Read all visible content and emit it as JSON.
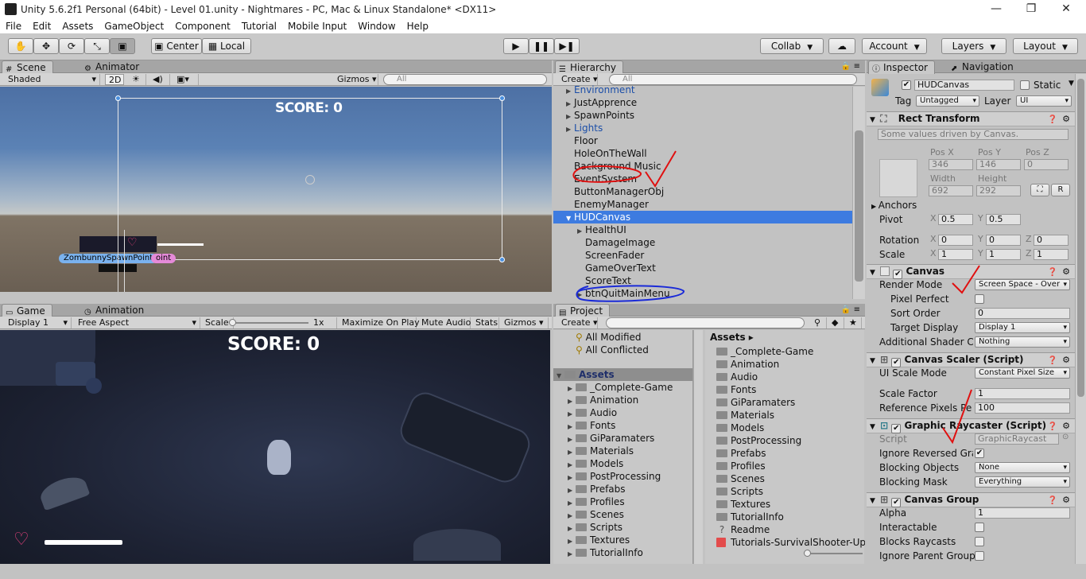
{
  "window": {
    "title": "Unity 5.6.2f1 Personal (64bit) - Level 01.unity - Nightmares - PC, Mac & Linux Standalone* <DX11>"
  },
  "menu": [
    "File",
    "Edit",
    "Assets",
    "GameObject",
    "Component",
    "Tutorial",
    "Mobile Input",
    "Window",
    "Help"
  ],
  "toolbar": {
    "center": "Center",
    "local": "Local",
    "collab": "Collab",
    "account": "Account",
    "layers": "Layers",
    "layout": "Layout"
  },
  "scene": {
    "tabs": [
      "Scene",
      "Animator"
    ],
    "shading": "Shaded",
    "mode2d": "2D",
    "gizmos": "Gizmos",
    "search": "All",
    "score": "SCORE: 0",
    "spawn_label": "ZombunnySpawnPoint",
    "spawn_label_tail": "oint"
  },
  "game": {
    "tabs": [
      "Game",
      "Animation"
    ],
    "display": "Display 1",
    "aspect": "Free Aspect",
    "scale_label": "Scale",
    "scale_value": "1x",
    "maximize": "Maximize On Play",
    "mute": "Mute Audio",
    "stats": "Stats",
    "gizmos": "Gizmos",
    "score": "SCORE: 0"
  },
  "hierarchy": {
    "tab": "Hierarchy",
    "create": "Create",
    "search": "All",
    "items": [
      {
        "label": "Environment",
        "indent": 1,
        "arrow": "▶",
        "blue": true
      },
      {
        "label": "JustApprence",
        "indent": 1,
        "arrow": "▶",
        "blue": false
      },
      {
        "label": "SpawnPoints",
        "indent": 1,
        "arrow": "▶",
        "blue": false
      },
      {
        "label": "Lights",
        "indent": 1,
        "arrow": "▶",
        "blue": true
      },
      {
        "label": "Floor",
        "indent": 1,
        "arrow": "",
        "blue": false
      },
      {
        "label": "HoleOnTheWall",
        "indent": 1,
        "arrow": "",
        "blue": false
      },
      {
        "label": "Background Music",
        "indent": 1,
        "arrow": "",
        "blue": false
      },
      {
        "label": "EventSystem",
        "indent": 1,
        "arrow": "",
        "blue": false
      },
      {
        "label": "ButtonManagerObj",
        "indent": 1,
        "arrow": "",
        "blue": false
      },
      {
        "label": "EnemyManager",
        "indent": 1,
        "arrow": "",
        "blue": false
      },
      {
        "label": "HUDCanvas",
        "indent": 1,
        "arrow": "▼",
        "blue": false,
        "selected": true
      },
      {
        "label": "HealthUI",
        "indent": 2,
        "arrow": "▶",
        "blue": false
      },
      {
        "label": "DamageImage",
        "indent": 2,
        "arrow": "",
        "blue": false
      },
      {
        "label": "ScreenFader",
        "indent": 2,
        "arrow": "",
        "blue": false
      },
      {
        "label": "GameOverText",
        "indent": 2,
        "arrow": "",
        "blue": false
      },
      {
        "label": "ScoreText",
        "indent": 2,
        "arrow": "",
        "blue": false
      },
      {
        "label": "btnQuitMainMenu",
        "indent": 2,
        "arrow": "▶",
        "blue": false
      }
    ]
  },
  "project": {
    "tab": "Project",
    "create": "Create",
    "favorites": [
      "All Modified",
      "All Conflicted"
    ],
    "tree_root": "Assets",
    "tree": [
      "_Complete-Game",
      "Animation",
      "Audio",
      "Fonts",
      "GiParamaters",
      "Materials",
      "Models",
      "PostProcessing",
      "Prefabs",
      "Profiles",
      "Scenes",
      "Scripts",
      "Textures",
      "TutorialInfo"
    ],
    "breadcrumb": "Assets",
    "assets": [
      "_Complete-Game",
      "Animation",
      "Audio",
      "Fonts",
      "GiParamaters",
      "Materials",
      "Models",
      "PostProcessing",
      "Prefabs",
      "Profiles",
      "Scenes",
      "Scripts",
      "Textures",
      "TutorialInfo",
      "Readme",
      "Tutorials-SurvivalShooter-Up"
    ]
  },
  "inspector": {
    "tabs": [
      "Inspector",
      "Navigation"
    ],
    "object_name": "HUDCanvas",
    "static_label": "Static",
    "tag_label": "Tag",
    "tag": "Untagged",
    "layer_label": "Layer",
    "layer": "UI",
    "rect": {
      "header": "Rect Transform",
      "note": "Some values driven by Canvas.",
      "pos_x_label": "Pos X",
      "pos_y_label": "Pos Y",
      "pos_z_label": "Pos Z",
      "pos_x": "346",
      "pos_y": "146",
      "pos_z": "0",
      "width_label": "Width",
      "height_label": "Height",
      "width": "692",
      "height": "292",
      "anchors": "Anchors",
      "pivot": "Pivot",
      "pivot_x": "0.5",
      "pivot_y": "0.5",
      "rotation": "Rotation",
      "rot_x": "0",
      "rot_y": "0",
      "rot_z": "0",
      "scale": "Scale",
      "scale_x": "1",
      "scale_y": "1",
      "scale_z": "1",
      "x": "X",
      "y": "Y",
      "z": "Z",
      "r_btn": "R"
    },
    "canvas": {
      "header": "Canvas",
      "render_mode_label": "Render Mode",
      "render_mode": "Screen Space - Over",
      "pixel_perfect": "Pixel Perfect",
      "sort_order_label": "Sort Order",
      "sort_order": "0",
      "target_display_label": "Target Display",
      "target_display": "Display 1",
      "shader_label": "Additional Shader Ch",
      "shader": "Nothing"
    },
    "scaler": {
      "header": "Canvas Scaler (Script)",
      "mode_label": "UI Scale Mode",
      "mode": "Constant Pixel Size",
      "factor_label": "Scale Factor",
      "factor": "1",
      "ref_label": "Reference Pixels Pe",
      "ref": "100"
    },
    "raycaster": {
      "header": "Graphic Raycaster (Script)",
      "script_label": "Script",
      "script": "GraphicRaycast",
      "ignore_label": "Ignore Reversed Gra",
      "blocking_label": "Blocking Objects",
      "blocking": "None",
      "mask_label": "Blocking Mask",
      "mask": "Everything"
    },
    "group": {
      "header": "Canvas Group",
      "alpha_label": "Alpha",
      "alpha": "1",
      "interactable": "Interactable",
      "blocks": "Blocks Raycasts",
      "ignore_parent": "Ignore Parent Group"
    }
  }
}
